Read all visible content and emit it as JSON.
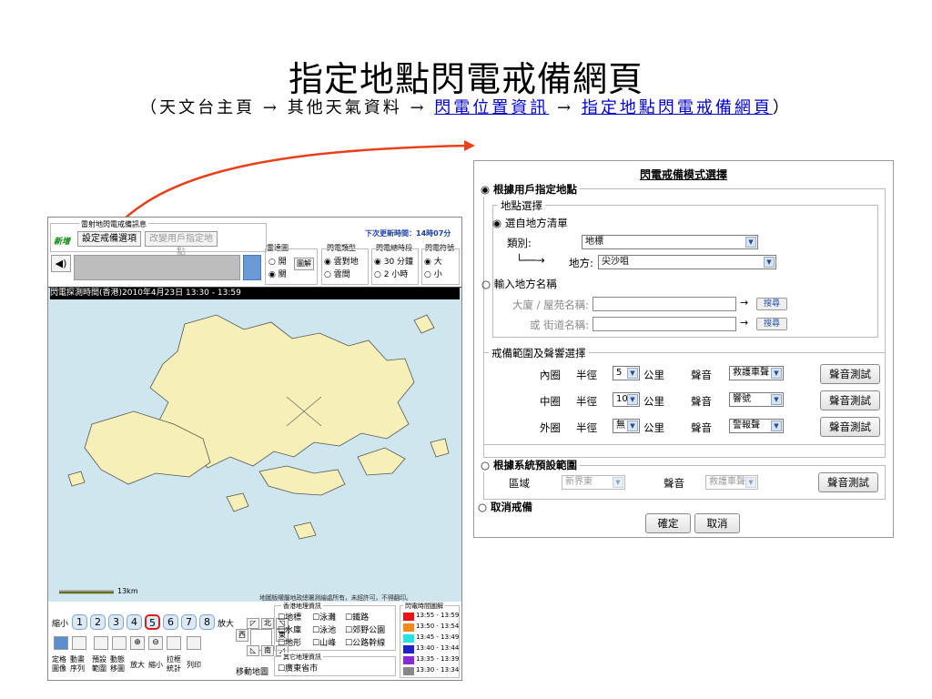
{
  "slide": {
    "title": "指定地點閃電戒備網頁",
    "breadcrumb": {
      "open": "（",
      "part1": "天文台主頁",
      "arrow": "→",
      "part2": "其他天氣資料",
      "link1": "閃電位置資訊",
      "link2": "指定地點閃電戒備網頁",
      "close": "）"
    },
    "arrow_color": "#e8401c"
  },
  "map_panel": {
    "header_label": "雷射地閃電戒備訊息",
    "new_badge": "新增",
    "set_alert_button": "設定戒備選項",
    "change_location_button": "改變用戶指定地點",
    "next_update": "下次更新時間：14時07分",
    "radar_group": {
      "label": "雷達圖",
      "on": "開",
      "off": "關",
      "legend_button": "圖解"
    },
    "type_group": {
      "label": "閃電類型",
      "opt1": "雲對地",
      "opt2": "雲間"
    },
    "period_group": {
      "label": "閃電總時段",
      "opt1": "30 分鐘",
      "opt2": "2 小時"
    },
    "size_group": {
      "label": "閃電符號",
      "opt1": "大",
      "opt2": "小"
    },
    "observe_time": "閃電探測時間(香港)2010年4月23日 13:30 - 13:59",
    "scale_label": "13km",
    "copyright": "地圖版權屬地政總署測繪處所有，未經許可，不得翻印。",
    "zoom_small": "縮小",
    "zoom_levels": [
      "1",
      "2",
      "3",
      "4",
      "5",
      "6",
      "7",
      "8"
    ],
    "zoom_big": "放大",
    "tools": [
      "定格圖像",
      "動畫序列",
      "預設範圍",
      "動態移圖",
      "放大",
      "縮小",
      "拉框統計",
      "列印"
    ],
    "pan_label": "移動地圖",
    "pan_dirs": {
      "north": "北",
      "south": "南",
      "west": "西",
      "east": "東"
    },
    "geo_info": {
      "title": "香港地理資訊",
      "items": [
        "地標",
        "泳灘",
        "鐵路",
        "水庫",
        "泳池",
        "郊野公園",
        "地形",
        "山峰",
        "公路幹線"
      ]
    },
    "other_geo": {
      "title": "其它地理資訊",
      "items": [
        "廣東省市"
      ]
    },
    "time_legend": {
      "title": "閃電時間圖解",
      "items": [
        {
          "label": "13:55 - 13:59",
          "color": "#ee1111"
        },
        {
          "label": "13:50 - 13:54",
          "color": "#f08a1c"
        },
        {
          "label": "13:45 - 13:49",
          "color": "#22e4e4"
        },
        {
          "label": "13:40 - 13:44",
          "color": "#2222cc"
        },
        {
          "label": "13:35 - 13:39",
          "color": "#8a2ad4"
        },
        {
          "label": "13:30 - 13:34",
          "color": "#888888"
        }
      ]
    },
    "colors": {
      "sea": "#cfe6ef",
      "land": "#f6f0b8",
      "selected_zoom": "#d42020"
    }
  },
  "settings": {
    "title": "閃電戒備模式選擇",
    "mode1": "根據用戶指定地點",
    "location_select": "地點選擇",
    "from_list": "選自地方清單",
    "category_label": "類別:",
    "category_value": "地標",
    "place_label": "地方:",
    "place_value": "尖沙咀",
    "input_name": "輸入地方名稱",
    "building_label": "大廈 / 屋苑名稱:",
    "street_label": "或 街道名稱:",
    "search_button": "搜尋",
    "range_title": "戒備範圍及聲響選擇",
    "rings": [
      {
        "name": "內圈",
        "radius": "5",
        "sound": "救護車聲"
      },
      {
        "name": "中圈",
        "radius": "10",
        "sound": "響號"
      },
      {
        "name": "外圈",
        "radius": "無",
        "sound": "警報聲"
      }
    ],
    "radius_label": "半徑",
    "km_label": "公里",
    "sound_label": "聲音",
    "test_button": "聲音測試",
    "mode2": "根據系統預設範圍",
    "region_label": "區域",
    "region_value": "新界東",
    "default_sound": "救護車聲",
    "mode3": "取消戒備",
    "confirm_button": "確定",
    "cancel_button": "取消"
  }
}
